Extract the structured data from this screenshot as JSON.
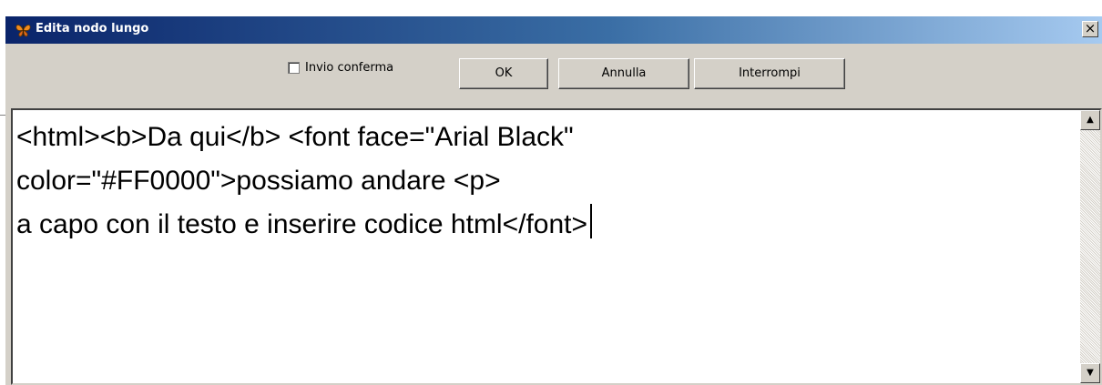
{
  "window": {
    "title": "Edita nodo lungo",
    "close_symbol": "×",
    "icon": "butterfly-icon"
  },
  "toolbar": {
    "checkbox_label": "Invio conferma",
    "checkbox_checked": false,
    "ok_label": "OK",
    "cancel_label": "Annulla",
    "interrupt_label": "Interrompi"
  },
  "editor": {
    "lines": [
      "<html><b>Da qui</b> <font face=\"Arial Black\"",
      "color=\"#FF0000\">possiamo andare <p>",
      "a capo con il testo e inserire codice html</font>"
    ]
  },
  "scrollbar": {
    "up_symbol": "▲",
    "down_symbol": "▼"
  },
  "colors": {
    "title_gradient_start": "#0a246a",
    "title_gradient_end": "#a6caf0",
    "face": "#d4d0c8"
  }
}
